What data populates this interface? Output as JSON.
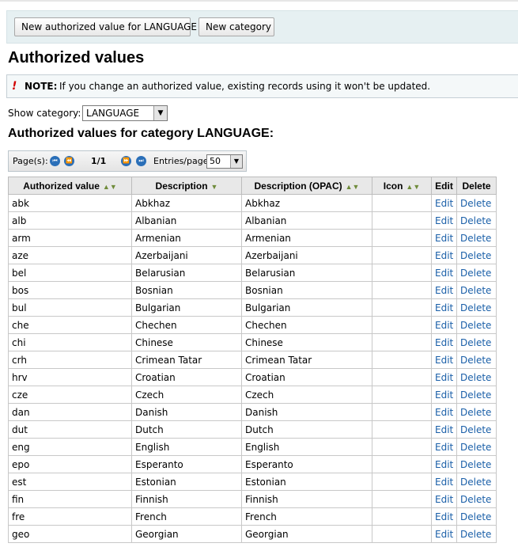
{
  "toolbar": {
    "new_value_label": "New authorized value for LANGUAGE",
    "new_category_label": "New category"
  },
  "page_title": "Authorized values",
  "note": {
    "icon": "!",
    "label": "NOTE:",
    "text": "If you change an authorized value, existing records using it won't be updated."
  },
  "category": {
    "label": "Show category:",
    "selected": "LANGUAGE"
  },
  "subtitle": "Authorized values for category LANGUAGE:",
  "pager": {
    "pages_label": "Page(s):",
    "current": "1/1",
    "entries_label": "Entries/page:",
    "entries_value": "50"
  },
  "table": {
    "headers": [
      "Authorized value",
      "Description",
      "Description (OPAC)",
      "Icon",
      "Edit",
      "Delete"
    ],
    "edit_label": "Edit",
    "delete_label": "Delete",
    "rows": [
      [
        "abk",
        "Abkhaz",
        "Abkhaz"
      ],
      [
        "alb",
        "Albanian",
        "Albanian"
      ],
      [
        "arm",
        "Armenian",
        "Armenian"
      ],
      [
        "aze",
        "Azerbaijani",
        "Azerbaijani"
      ],
      [
        "bel",
        "Belarusian",
        "Belarusian"
      ],
      [
        "bos",
        "Bosnian",
        "Bosnian"
      ],
      [
        "bul",
        "Bulgarian",
        "Bulgarian"
      ],
      [
        "che",
        "Chechen",
        "Chechen"
      ],
      [
        "chi",
        "Chinese",
        "Chinese"
      ],
      [
        "crh",
        "Crimean Tatar",
        "Crimean Tatar"
      ],
      [
        "hrv",
        "Croatian",
        "Croatian"
      ],
      [
        "cze",
        "Czech",
        "Czech"
      ],
      [
        "dan",
        "Danish",
        "Danish"
      ],
      [
        "dut",
        "Dutch",
        "Dutch"
      ],
      [
        "eng",
        "English",
        "English"
      ],
      [
        "epo",
        "Esperanto",
        "Esperanto"
      ],
      [
        "est",
        "Estonian",
        "Estonian"
      ],
      [
        "fin",
        "Finnish",
        "Finnish"
      ],
      [
        "fre",
        "French",
        "French"
      ],
      [
        "geo",
        "Georgian",
        "Georgian"
      ]
    ]
  }
}
